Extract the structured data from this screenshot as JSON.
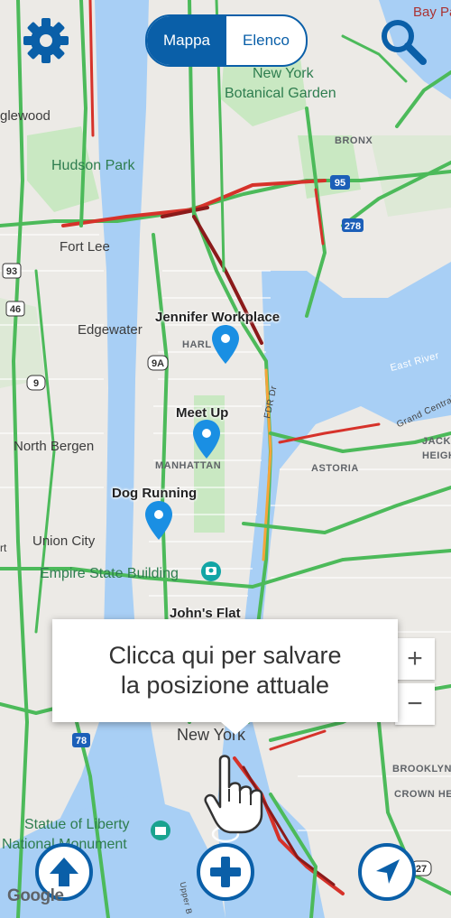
{
  "toggle": {
    "map_label": "Mappa",
    "list_label": "Elenco"
  },
  "icons": {
    "settings": "gear-icon",
    "search": "search-icon",
    "zoom_in": "plus-icon",
    "zoom_out": "minus-icon",
    "upload": "arrow-up-icon",
    "add": "plus-icon",
    "locate": "navigation-arrow-icon",
    "hand": "pointing-hand-icon"
  },
  "colors": {
    "accent": "#0a5fa8",
    "pin": "#1a8fe3",
    "traffic_green": "#4cba5a",
    "traffic_orange": "#f4a53a",
    "traffic_red": "#d6322a",
    "water": "#a8cff5",
    "park": "#c9e8c2"
  },
  "pins": [
    {
      "label": "Jennifer Workplace"
    },
    {
      "label": "Meet Up"
    },
    {
      "label": "Dog Running"
    },
    {
      "label": "John's Flat"
    }
  ],
  "map_labels": {
    "parks": [
      "Hudson Park",
      "Empire State Building",
      "Statue of Liberty",
      "National Monument",
      "New York",
      "Botanical Garden"
    ],
    "places": [
      "Fort Lee",
      "Edgewater",
      "North Bergen",
      "Union City",
      "glewood",
      "New York"
    ],
    "districts": [
      "BRONX",
      "HARL",
      "MANHATTAN",
      "ASTORIA",
      "BROOKLYN",
      "CROWN HE",
      "JACK",
      "HEIGH",
      "East River",
      "Grand Central Pkwy",
      "FDR Dr",
      "Upper B",
      "Bay Pa",
      "rt"
    ],
    "shields": [
      "95",
      "278",
      "93",
      "46",
      "9",
      "9A",
      "78",
      "478",
      "27"
    ]
  },
  "tooltip": {
    "text": "Clicca qui per salvare\nla posizione attuale"
  },
  "zoom": {
    "in": "+",
    "out": "−"
  },
  "attribution": "Google"
}
